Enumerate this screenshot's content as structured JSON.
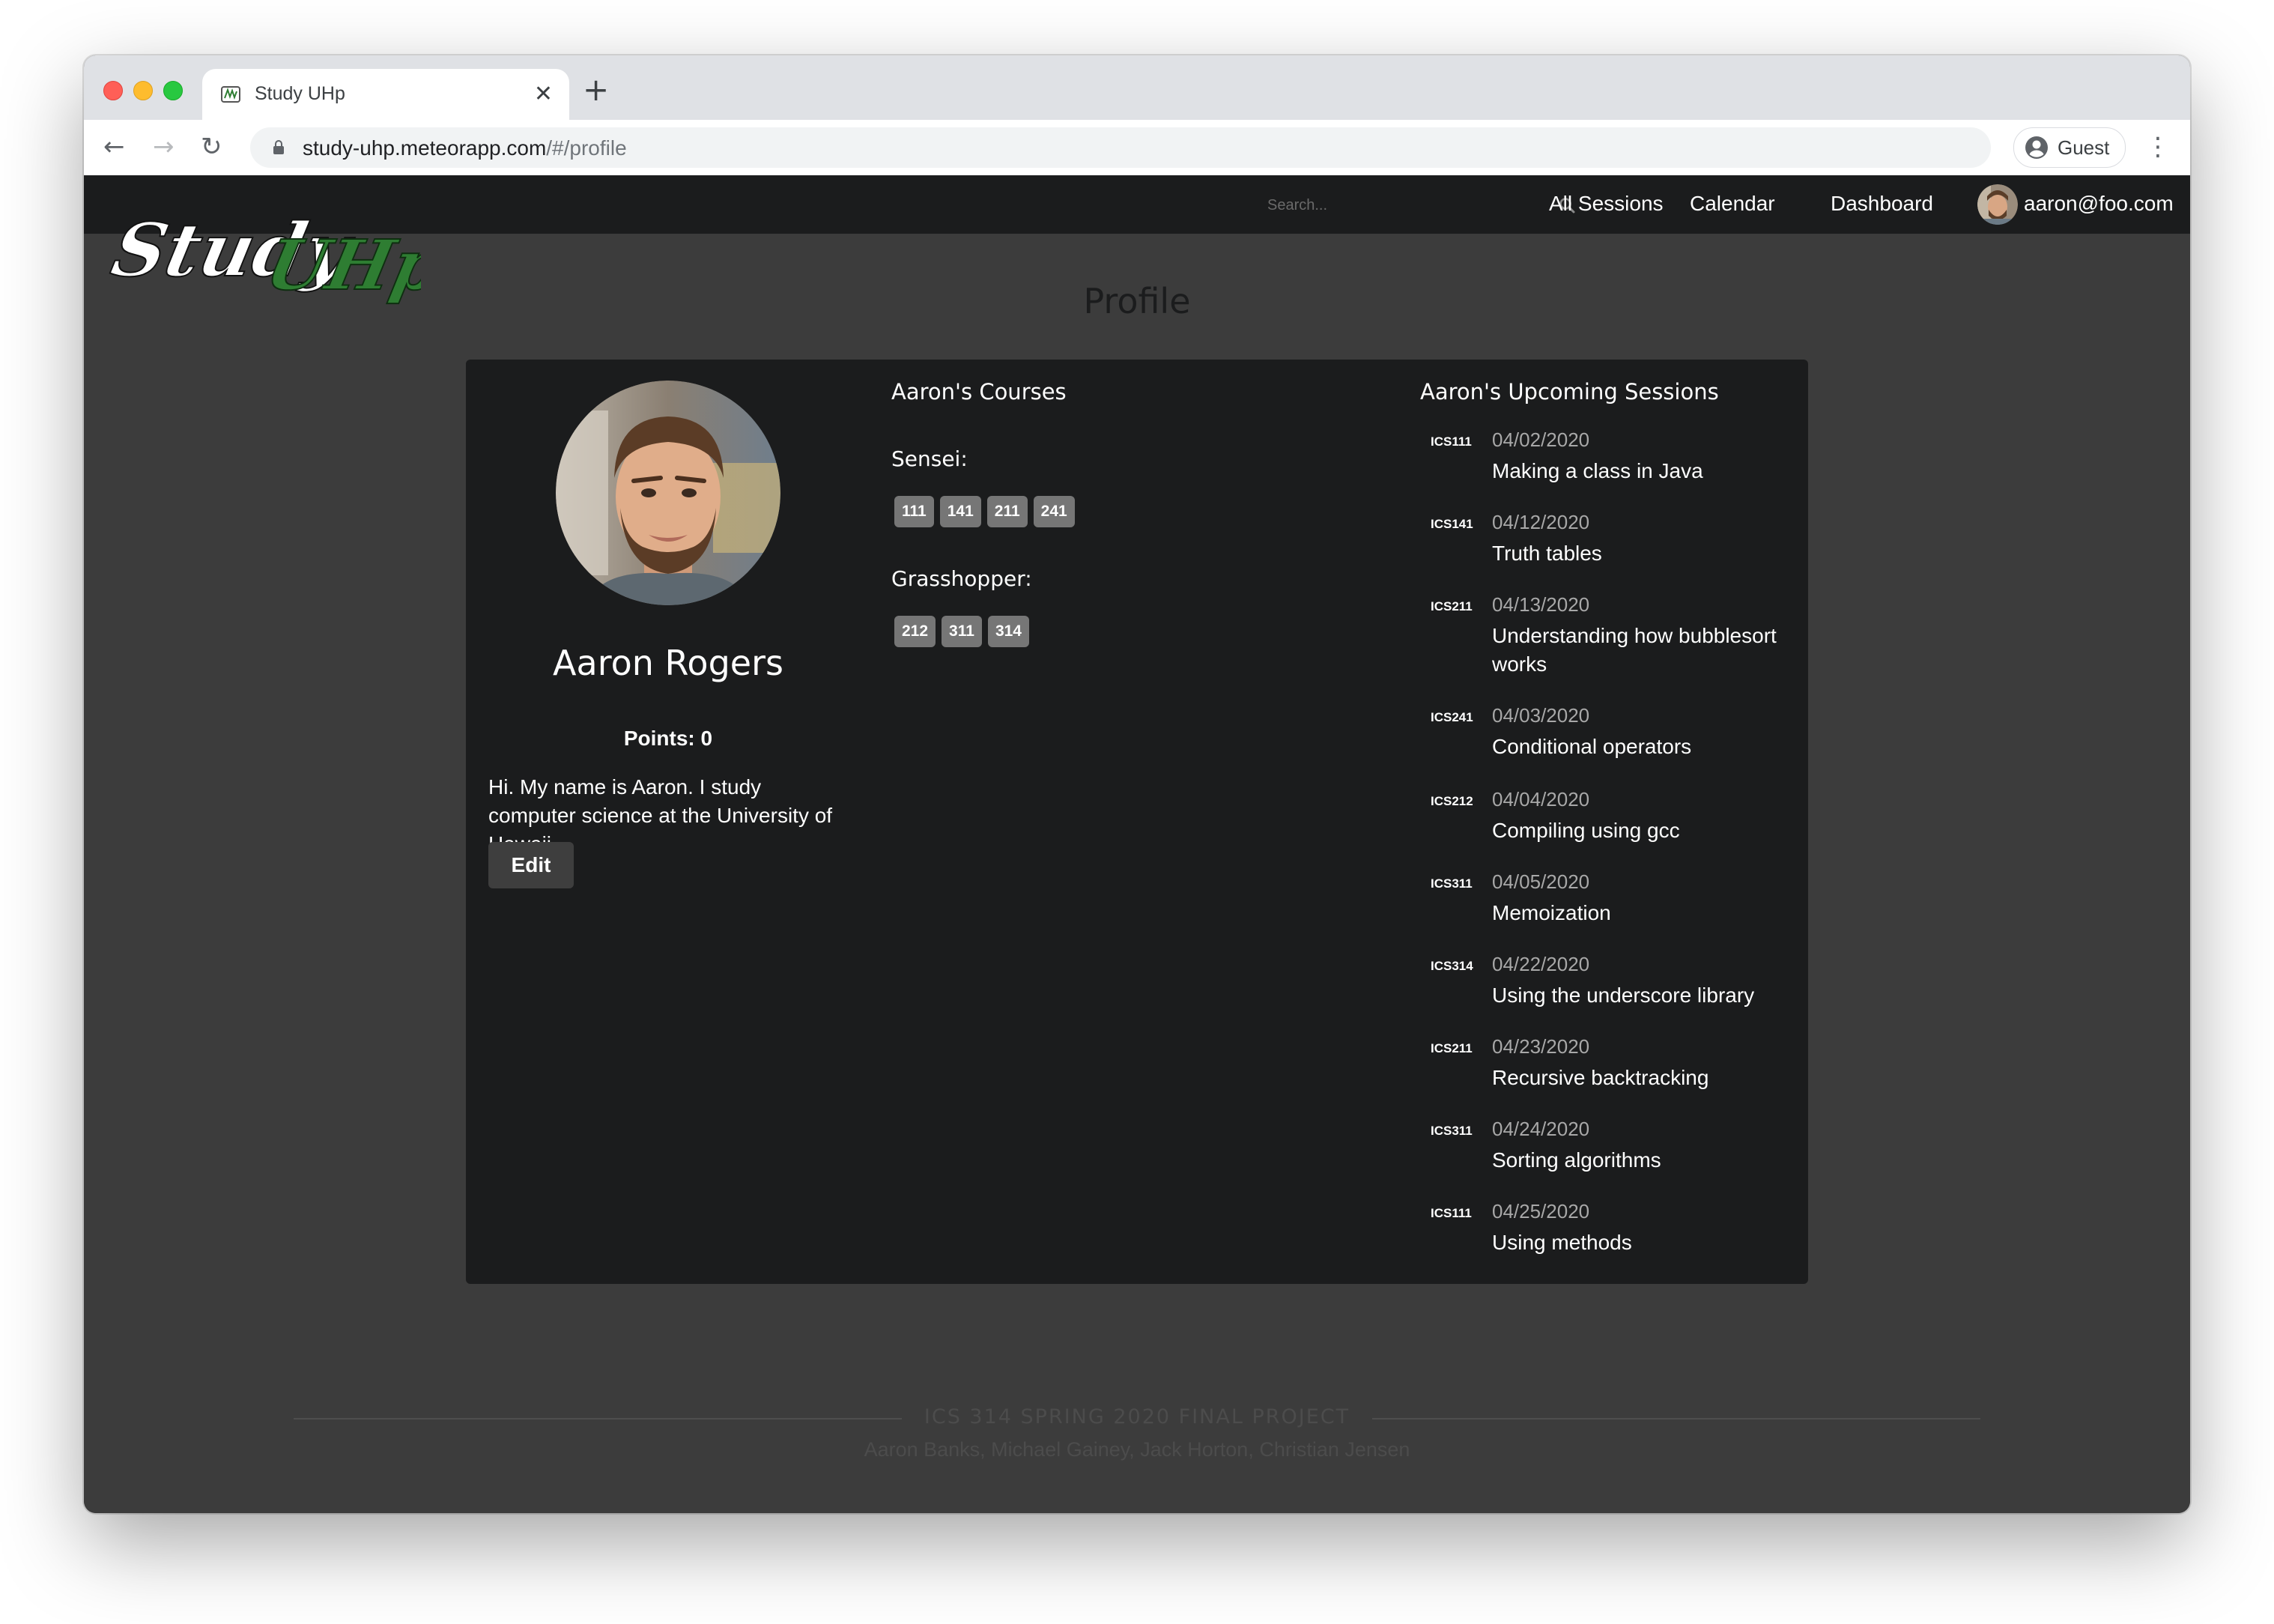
{
  "browser": {
    "tab_title": "Study UHp",
    "tab_close": "✕",
    "new_tab": "+",
    "url_host": "study-uhp.meteorapp.com",
    "url_path": "/#/profile",
    "profile_label": "Guest",
    "nav_back": "←",
    "nav_forward": "→",
    "nav_reload": "↻",
    "menu": "⋮"
  },
  "site": {
    "logo_text_part1": "Study",
    "logo_text_part2": "UHp",
    "search_placeholder": "Search...",
    "nav_links": [
      "All Sessions",
      "Calendar",
      "Dashboard"
    ],
    "user_email": "aaron@foo.com"
  },
  "profile": {
    "page_title": "Profile",
    "name": "Aaron Rogers",
    "points": "Points: 0",
    "bio": "Hi. My name is Aaron. I study computer science at the University of Hawaii.",
    "edit_label": "Edit",
    "courses_header": "Aaron's Courses",
    "sensei_label": "Sensei:",
    "sensei_courses": [
      "111",
      "141",
      "211",
      "241"
    ],
    "grasshopper_label": "Grasshopper:",
    "grasshopper_courses": [
      "212",
      "311",
      "314"
    ],
    "sessions_header": "Aaron's Upcoming Sessions",
    "sessions": [
      {
        "course": "ICS111",
        "date": "04/02/2020",
        "topic": "Making a class in Java"
      },
      {
        "course": "ICS141",
        "date": "04/12/2020",
        "topic": "Truth tables"
      },
      {
        "course": "ICS211",
        "date": "04/13/2020",
        "topic": "Understanding how bubblesort works"
      },
      {
        "course": "ICS241",
        "date": "04/03/2020",
        "topic": "Conditional operators"
      },
      {
        "course": "ICS212",
        "date": "04/04/2020",
        "topic": "Compiling using gcc"
      },
      {
        "course": "ICS311",
        "date": "04/05/2020",
        "topic": "Memoization"
      },
      {
        "course": "ICS314",
        "date": "04/22/2020",
        "topic": "Using the underscore library"
      },
      {
        "course": "ICS211",
        "date": "04/23/2020",
        "topic": "Recursive backtracking"
      },
      {
        "course": "ICS311",
        "date": "04/24/2020",
        "topic": "Sorting algorithms"
      },
      {
        "course": "ICS111",
        "date": "04/25/2020",
        "topic": "Using methods"
      }
    ]
  },
  "footer": {
    "title": "ICS 314 SPRING 2020 FINAL PROJECT",
    "authors": "Aaron Banks, Michael Gainey, Jack Horton, Christian Jensen"
  },
  "colors": {
    "nav_bg": "#1b1c1d",
    "page_bg": "#3c3c3c",
    "card_bg": "#1b1c1d",
    "label_bg": "#767676",
    "logo_green": "#2e7d32"
  },
  "icons": {
    "search": "magnifier",
    "lock": "padlock",
    "guest": "person-circle"
  }
}
